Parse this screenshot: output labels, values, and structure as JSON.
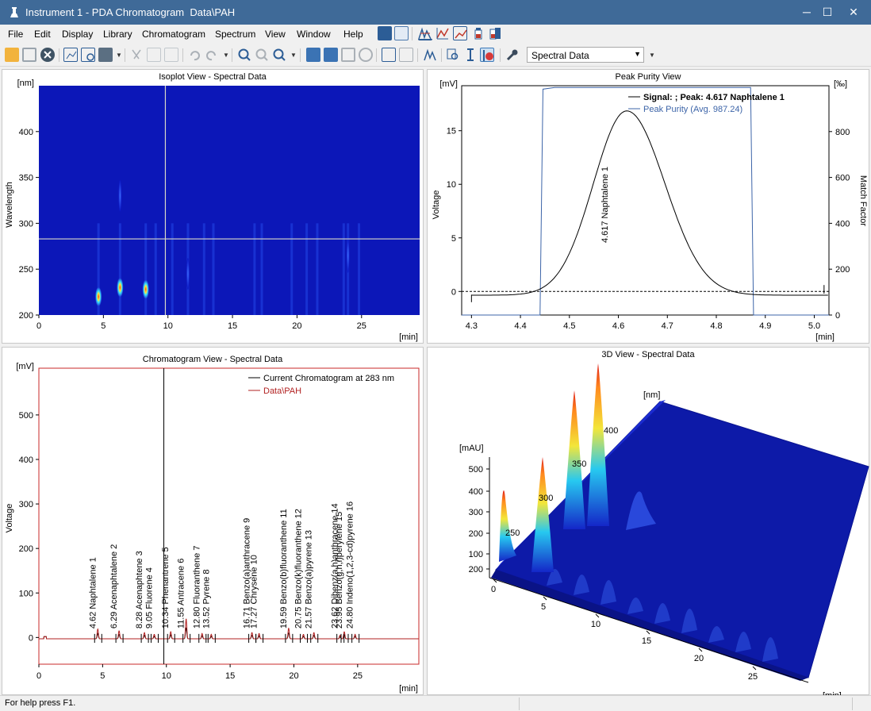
{
  "window": {
    "title": "Instrument 1 - PDA Chromatogram  Data\\PAH",
    "min_icon": "minimize-icon",
    "max_icon": "maximize-icon",
    "close_icon": "close-icon"
  },
  "menu": [
    "File",
    "Edit",
    "Display",
    "Library",
    "Chromatogram",
    "Spectrum",
    "View",
    "Window",
    "Help"
  ],
  "toolbar": {
    "combo_value": "Spectral Data"
  },
  "status": {
    "text": "For help press F1."
  },
  "isoplot": {
    "title": "Isoplot View - Spectral Data",
    "yunit": "[nm]",
    "ylabel": "Wavelength",
    "xunit": "[min]",
    "xticks": [
      "0",
      "5",
      "10",
      "15",
      "20",
      "25"
    ],
    "yticks": [
      "200",
      "250",
      "300",
      "350",
      "400"
    ],
    "cursor_time": 9.8,
    "cursor_wavelength": 283
  },
  "purity": {
    "title": "Peak Purity View",
    "yunit": "[mV]",
    "ylabel": "Voltage",
    "y2unit": "[‰]",
    "y2label": "Match Factor",
    "xunit": "[min]",
    "xticks": [
      "4.3",
      "4.4",
      "4.5",
      "4.6",
      "4.7",
      "4.8",
      "4.9",
      "5.0"
    ],
    "yticks": [
      "0",
      "5",
      "10",
      "15"
    ],
    "y2ticks": [
      "0",
      "200",
      "400",
      "600",
      "800"
    ],
    "legend_signal": "Signal: ; Peak: 4.617 Naphtalene   1",
    "legend_purity": "Peak Purity (Avg. 987.24)",
    "peak_label": "4.617 Naphtalene   1"
  },
  "chromatogram": {
    "title": "Chromatogram View - Spectral Data",
    "yunit": "[mV]",
    "ylabel": "Voltage",
    "xunit": "[min]",
    "xticks": [
      "0",
      "5",
      "10",
      "15",
      "20",
      "25"
    ],
    "yticks": [
      "0",
      "100",
      "200",
      "300",
      "400",
      "500"
    ],
    "legend_current": "Current Chromatogram at 283 nm",
    "legend_data": "Data\\PAH",
    "cursor_time": 9.8
  },
  "view3d": {
    "title": "3D View - Spectral Data",
    "nm_unit": "[nm]",
    "mau_unit": "[mAU]",
    "min_unit": "[min]",
    "mau_ticks": [
      "500",
      "400",
      "300",
      "200",
      "100",
      "200"
    ],
    "nm_ticks": [
      "400",
      "350",
      "300",
      "250"
    ],
    "time_ticks": [
      "0",
      "5",
      "10",
      "15",
      "20",
      "25"
    ]
  },
  "peaks": [
    {
      "time": 4.62,
      "name": "Naphtalene",
      "num": "1",
      "label": "4.62 Naphtalene   1"
    },
    {
      "time": 6.29,
      "name": "Acenaphtalene",
      "num": "2",
      "label": "6.29 Acenaphtalene   2"
    },
    {
      "time": 8.28,
      "name": "Acenaphtene",
      "num": "3",
      "label": "8.28 Acenaphtene   3"
    },
    {
      "time": 9.05,
      "name": "Fluorene",
      "num": "4",
      "label": "9.05 Fluorene   4"
    },
    {
      "time": 10.34,
      "name": "Phenantrene",
      "num": "5",
      "label": "10.34 Phenantrene   5"
    },
    {
      "time": 11.55,
      "name": "Antracene",
      "num": "6",
      "label": "11.55 Antracene   6"
    },
    {
      "time": 12.8,
      "name": "Fluoranthene",
      "num": "7",
      "label": "12.80 Fluoranthene   7"
    },
    {
      "time": 13.52,
      "name": "Pyrene",
      "num": "8",
      "label": "13.52 Pyrene   8"
    },
    {
      "time": 16.71,
      "name": "Benzo(a)anthracene",
      "num": "9",
      "label": "16.71 Benzo(a)anthracene   9"
    },
    {
      "time": 17.27,
      "name": "Chrysene",
      "num": "10",
      "label": "17.27 Chrysene   10"
    },
    {
      "time": 19.59,
      "name": "Benzo(b)fluoranthene",
      "num": "11",
      "label": "19.59 Benzo(b)fluoranthene   11"
    },
    {
      "time": 20.75,
      "name": "Benzo(k)fluoranthene",
      "num": "12",
      "label": "20.75 Benzo(k)fluoranthene   12"
    },
    {
      "time": 21.57,
      "name": "Benzo(a)pyrene",
      "num": "13",
      "label": "21.57 Benzo(a)pyrene   13"
    },
    {
      "time": 23.62,
      "name": "Dibenz(a,h)anthracene",
      "num": "14",
      "label": "23.62 Dibenz(a,h)anthracene   14"
    },
    {
      "time": 23.95,
      "name": "Benzo(g,h,i)perylene",
      "num": "15",
      "label": "23.95 Benzo(g,h,i)perylene   15"
    },
    {
      "time": 24.8,
      "name": "Indeno(1,2,3-cd)pyrene",
      "num": "16",
      "label": "24.80 Indeno(1,2,3-cd)pyrene   16"
    }
  ]
}
